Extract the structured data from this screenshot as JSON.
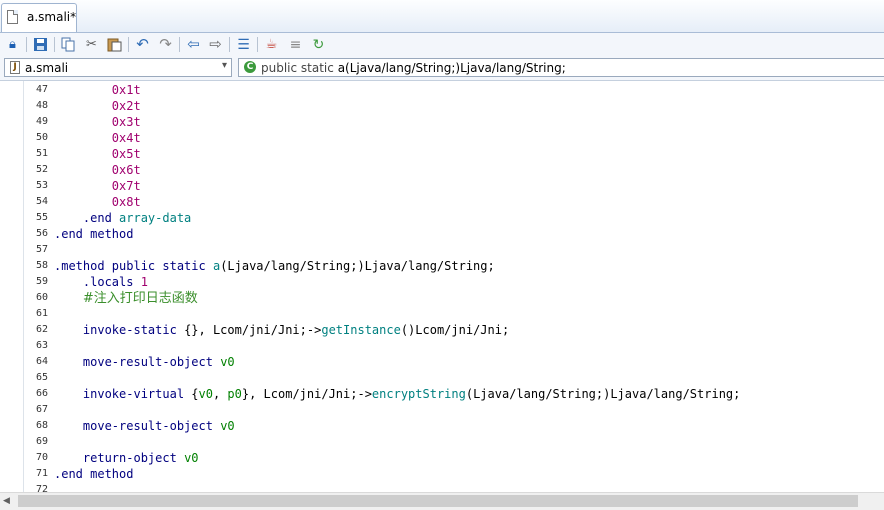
{
  "tab": {
    "label": "a.smali*"
  },
  "toolbar": {
    "buttons": [
      "lock-icon",
      "save-icon",
      "copy-icon",
      "cut-icon",
      "paste-icon",
      "undo-icon",
      "redo-icon",
      "back-arrow-icon",
      "forward-arrow-icon",
      "format-icon",
      "java-icon",
      "align-icon",
      "refresh-icon"
    ]
  },
  "combo": {
    "file": "a.smali",
    "method_prefix": "public static ",
    "method_signature": "a(Ljava/lang/String;)Ljava/lang/String;"
  },
  "editor": {
    "lines": [
      {
        "n": "47",
        "tokens": [
          [
            "        ",
            ""
          ],
          [
            "0x1t",
            "num"
          ]
        ]
      },
      {
        "n": "48",
        "tokens": [
          [
            "        ",
            ""
          ],
          [
            "0x2t",
            "num"
          ]
        ]
      },
      {
        "n": "49",
        "tokens": [
          [
            "        ",
            ""
          ],
          [
            "0x3t",
            "num"
          ]
        ]
      },
      {
        "n": "50",
        "tokens": [
          [
            "        ",
            ""
          ],
          [
            "0x4t",
            "num"
          ]
        ]
      },
      {
        "n": "51",
        "tokens": [
          [
            "        ",
            ""
          ],
          [
            "0x5t",
            "num"
          ]
        ]
      },
      {
        "n": "52",
        "tokens": [
          [
            "        ",
            ""
          ],
          [
            "0x6t",
            "num"
          ]
        ]
      },
      {
        "n": "53",
        "tokens": [
          [
            "        ",
            ""
          ],
          [
            "0x7t",
            "num"
          ]
        ]
      },
      {
        "n": "54",
        "tokens": [
          [
            "        ",
            ""
          ],
          [
            "0x8t",
            "num"
          ]
        ]
      },
      {
        "n": "55",
        "tokens": [
          [
            "    ",
            ""
          ],
          [
            ".end ",
            "kw"
          ],
          [
            "array-data",
            "fn"
          ]
        ]
      },
      {
        "n": "56",
        "tokens": [
          [
            ".end method",
            "kw"
          ]
        ]
      },
      {
        "n": "57",
        "tokens": []
      },
      {
        "n": "58",
        "tokens": [
          [
            ".method public static ",
            "kw"
          ],
          [
            "a",
            "fn"
          ],
          [
            "(Ljava/lang/String;)Ljava/lang/String;",
            ""
          ]
        ]
      },
      {
        "n": "59",
        "tokens": [
          [
            "    ",
            ""
          ],
          [
            ".locals ",
            "kw"
          ],
          [
            "1",
            "num"
          ]
        ]
      },
      {
        "n": "60",
        "tokens": [
          [
            "    ",
            ""
          ],
          [
            "#注入打印日志函数",
            "cmt"
          ]
        ]
      },
      {
        "n": "61",
        "tokens": []
      },
      {
        "n": "62",
        "tokens": [
          [
            "    ",
            ""
          ],
          [
            "invoke-static ",
            "kw"
          ],
          [
            "{}, Lcom/jni/Jni;->",
            ""
          ],
          [
            "getInstance",
            "fn"
          ],
          [
            "()Lcom/jni/Jni;",
            ""
          ]
        ]
      },
      {
        "n": "63",
        "tokens": []
      },
      {
        "n": "64",
        "tokens": [
          [
            "    ",
            ""
          ],
          [
            "move-result-object ",
            "kw"
          ],
          [
            "v0",
            "reg"
          ]
        ]
      },
      {
        "n": "65",
        "tokens": []
      },
      {
        "n": "66",
        "tokens": [
          [
            "    ",
            ""
          ],
          [
            "invoke-virtual ",
            "kw"
          ],
          [
            "{",
            ""
          ],
          [
            "v0",
            "reg"
          ],
          [
            ", ",
            ""
          ],
          [
            "p0",
            "reg"
          ],
          [
            "}, Lcom/jni/Jni;->",
            ""
          ],
          [
            "encryptString",
            "fn"
          ],
          [
            "(Ljava/lang/String;)Ljava/lang/String;",
            ""
          ]
        ]
      },
      {
        "n": "67",
        "tokens": []
      },
      {
        "n": "68",
        "tokens": [
          [
            "    ",
            ""
          ],
          [
            "move-result-object ",
            "kw"
          ],
          [
            "v0",
            "reg"
          ]
        ]
      },
      {
        "n": "69",
        "tokens": []
      },
      {
        "n": "70",
        "tokens": [
          [
            "    ",
            ""
          ],
          [
            "return-object ",
            "kw"
          ],
          [
            "v0",
            "reg"
          ]
        ]
      },
      {
        "n": "71",
        "tokens": [
          [
            ".end method",
            "kw"
          ]
        ]
      },
      {
        "n": "72",
        "tokens": []
      }
    ]
  }
}
